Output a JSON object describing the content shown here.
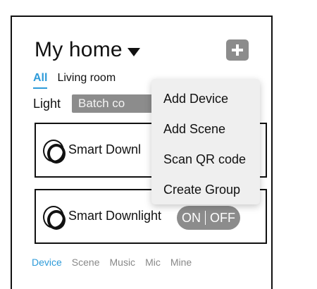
{
  "header": {
    "title": "My home"
  },
  "tabs": [
    {
      "label": "All"
    },
    {
      "label": "Living room"
    }
  ],
  "filter": {
    "label": "Light",
    "batch_button": "Batch co"
  },
  "devices": [
    {
      "name": "Smart Downl"
    },
    {
      "name": "Smart Downlight",
      "toggle_on": "ON",
      "toggle_off": "OFF"
    }
  ],
  "menu": {
    "items": [
      {
        "label": "Add Device"
      },
      {
        "label": "Add Scene"
      },
      {
        "label": "Scan QR code"
      },
      {
        "label": "Create Group"
      }
    ]
  },
  "bottom_nav": [
    {
      "label": "Device"
    },
    {
      "label": "Scene"
    },
    {
      "label": "Music"
    },
    {
      "label": "Mic"
    },
    {
      "label": "Mine"
    }
  ],
  "colors": {
    "accent": "#2e9bd9",
    "gray": "#8c8c8c",
    "menu_bg": "#efefef"
  }
}
